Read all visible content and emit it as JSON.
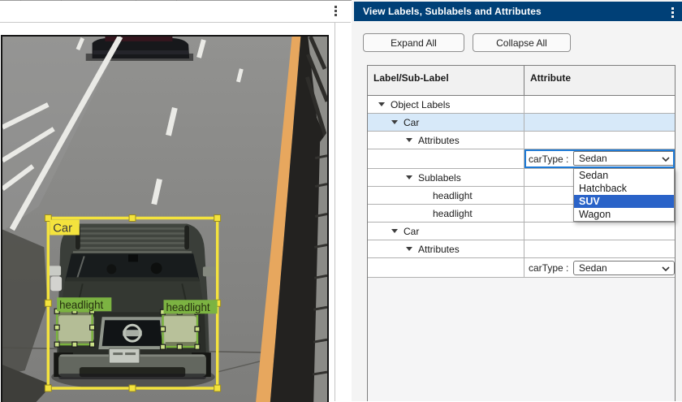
{
  "left_panel": {
    "description": "video frame with label annotations"
  },
  "right_panel": {
    "title": "View Labels, Sublabels and Attributes",
    "expand_all": "Expand All",
    "collapse_all": "Collapse All",
    "table": {
      "col_label": "Label/Sub-Label",
      "col_attribute": "Attribute",
      "rows": [
        {
          "label": "Object Labels",
          "level": 1,
          "expanded": true
        },
        {
          "label": "Car",
          "level": 2,
          "expanded": true,
          "selected": true
        },
        {
          "label": "Attributes",
          "level": 3,
          "expanded": true
        },
        {
          "type": "attribute",
          "name": "carType :",
          "value": "Sedan",
          "focused": true
        },
        {
          "label": "Sublabels",
          "level": 3,
          "expanded": true
        },
        {
          "label": "headlight",
          "level": 4
        },
        {
          "label": "headlight",
          "level": 4
        },
        {
          "label": "Car",
          "level": 2,
          "expanded": true
        },
        {
          "label": "Attributes",
          "level": 3,
          "expanded": true
        },
        {
          "type": "attribute",
          "name": "carType :",
          "value": "Sedan",
          "focused": false
        }
      ]
    },
    "dropdown": {
      "options": [
        "Sedan",
        "Hatchback",
        "SUV",
        "Wagon"
      ],
      "highlighted": "SUV"
    }
  },
  "image_annotations": {
    "car_label": "Car",
    "headlight_label_left": "headlight",
    "headlight_label_right": "headlight"
  },
  "colors": {
    "panel_header_navy": "#004077",
    "selected_row_blue": "#D7E9F9",
    "dropdown_selected_blue": "#2A63C8",
    "focus_border_blue": "#1E7AD6",
    "bbox_yellow": "#F4E33D",
    "sublabel_green": "#7CB342"
  }
}
